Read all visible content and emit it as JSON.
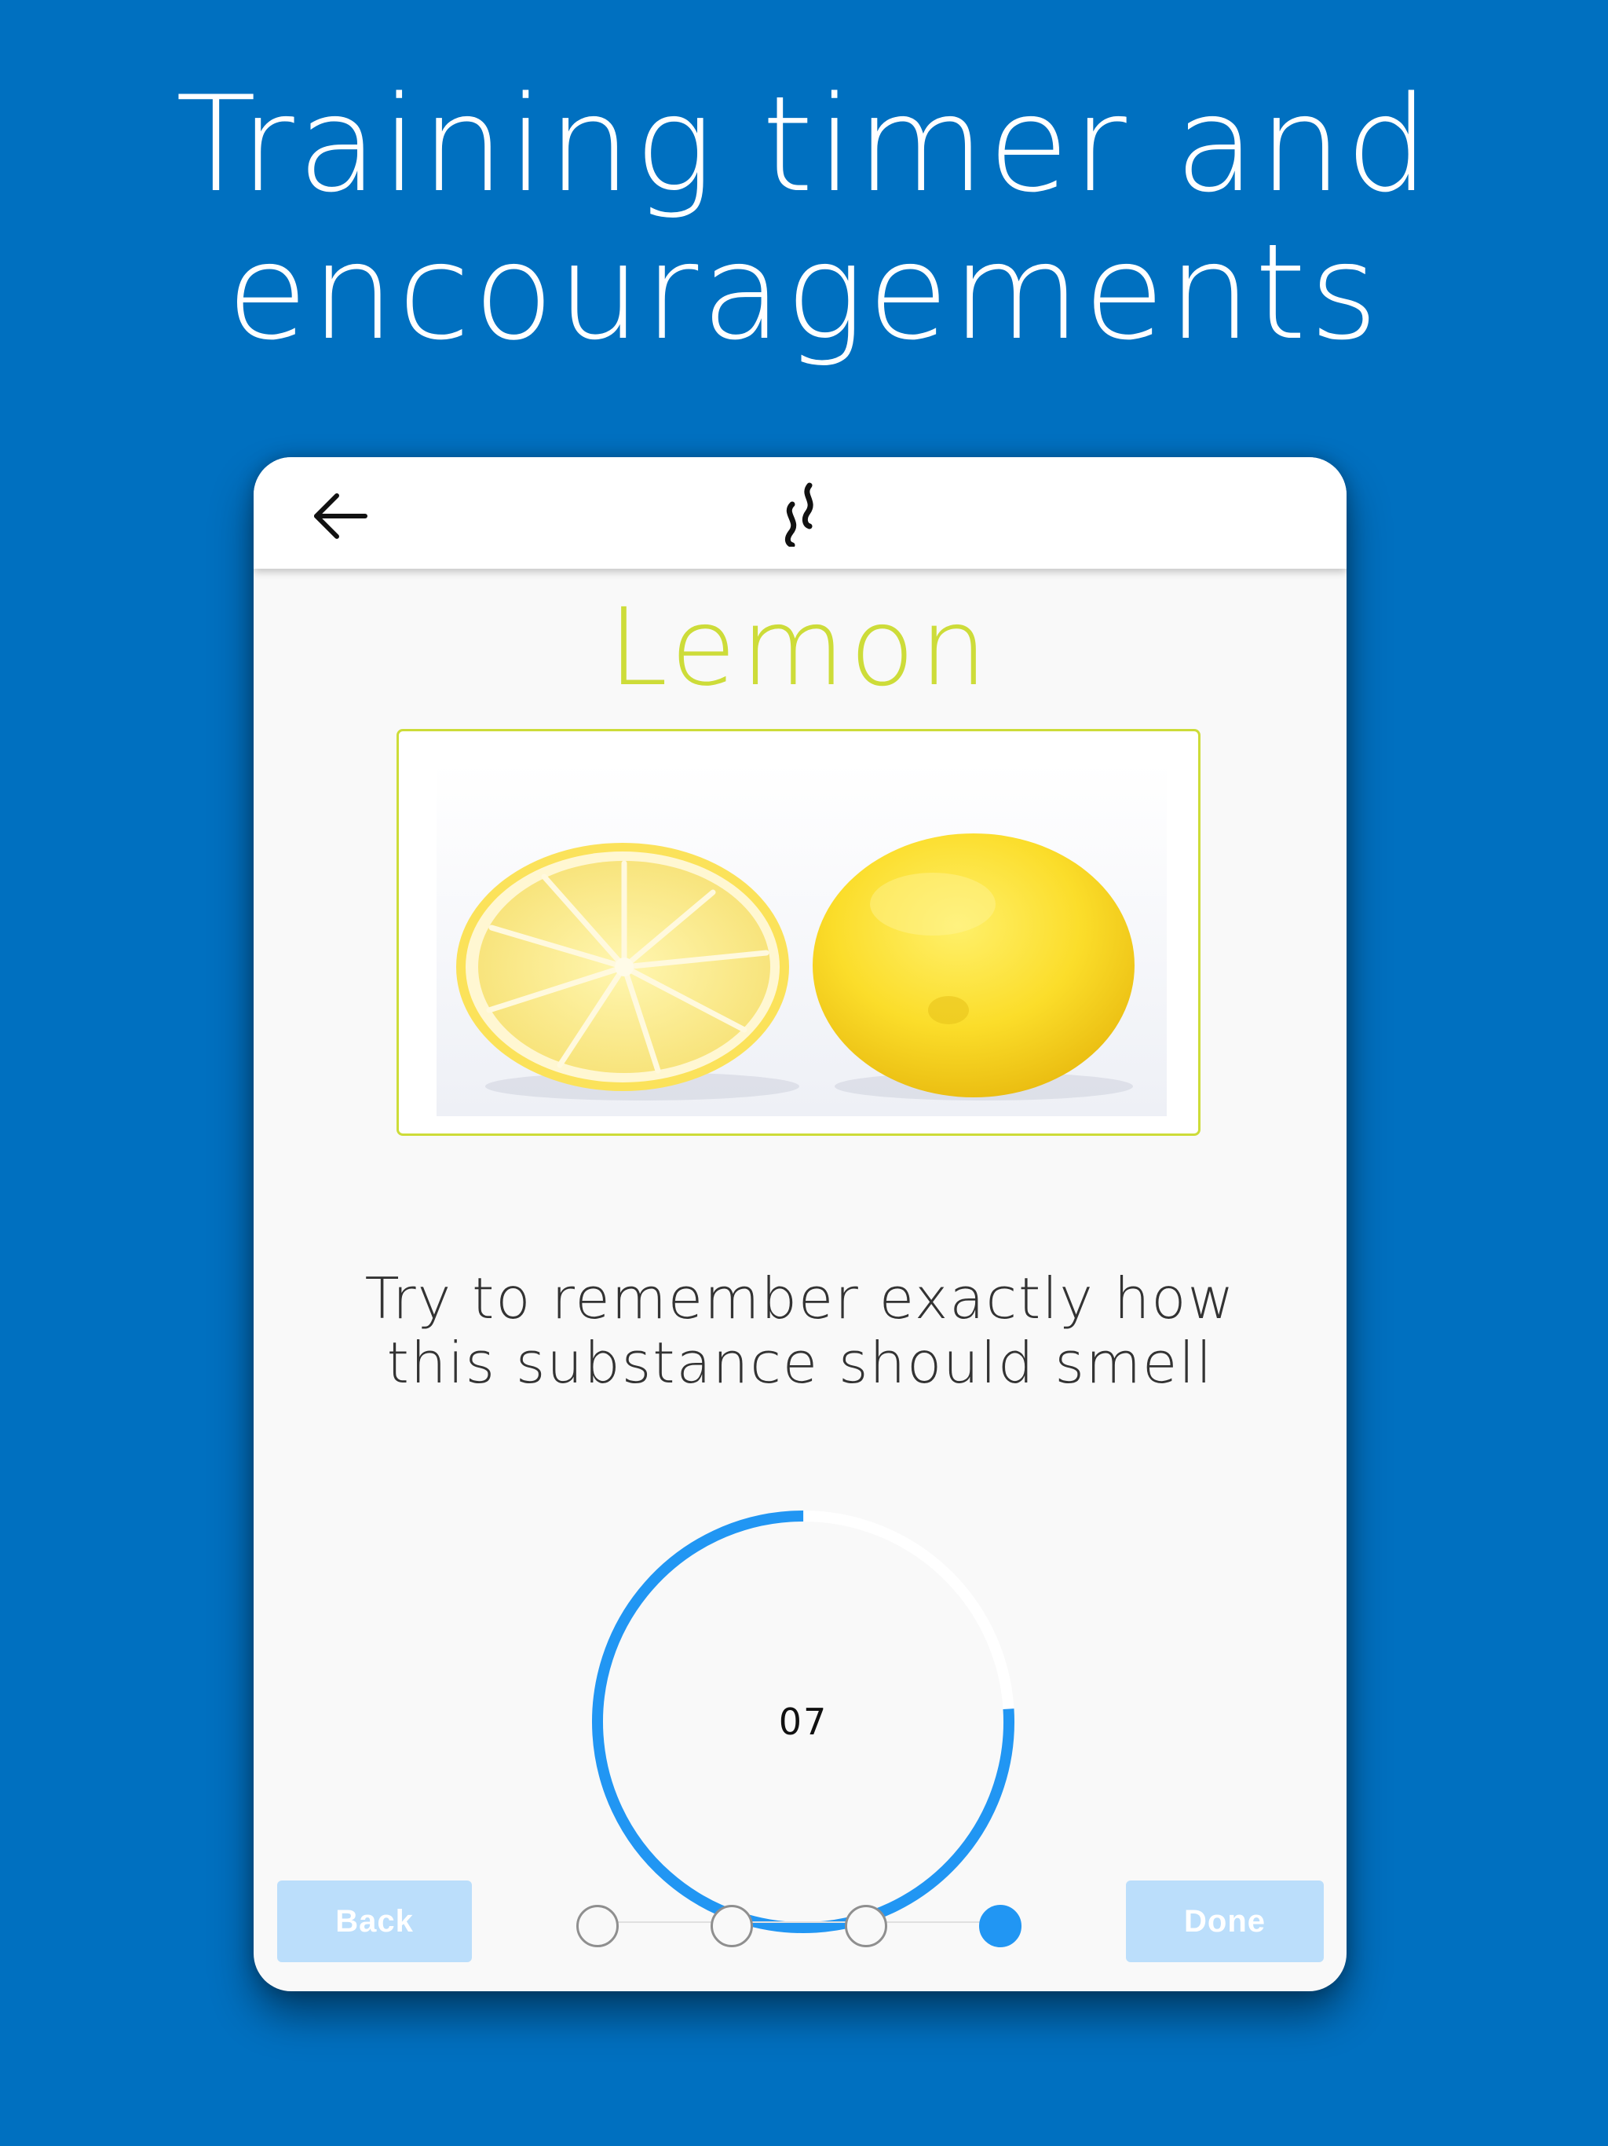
{
  "banner": {
    "line1": "Training timer and",
    "line2": "encouragements"
  },
  "appbar": {
    "back_icon": "arrow-left-icon",
    "logo_icon": "smell-wave-icon"
  },
  "scent": {
    "name": "Lemon",
    "image": "lemon-halves-photo"
  },
  "instruction": {
    "line1": "Try to remember exactly how",
    "line2": "this substance should smell"
  },
  "timer": {
    "value": "07",
    "progress_fraction": 0.76
  },
  "navigation": {
    "back_label": "Back",
    "done_label": "Done",
    "steps_total": 4,
    "current_step": 4
  },
  "colors": {
    "background": "#0070C0",
    "accent": "#2196F3",
    "title": "#CDDC39",
    "button": "#BBDEFB"
  }
}
